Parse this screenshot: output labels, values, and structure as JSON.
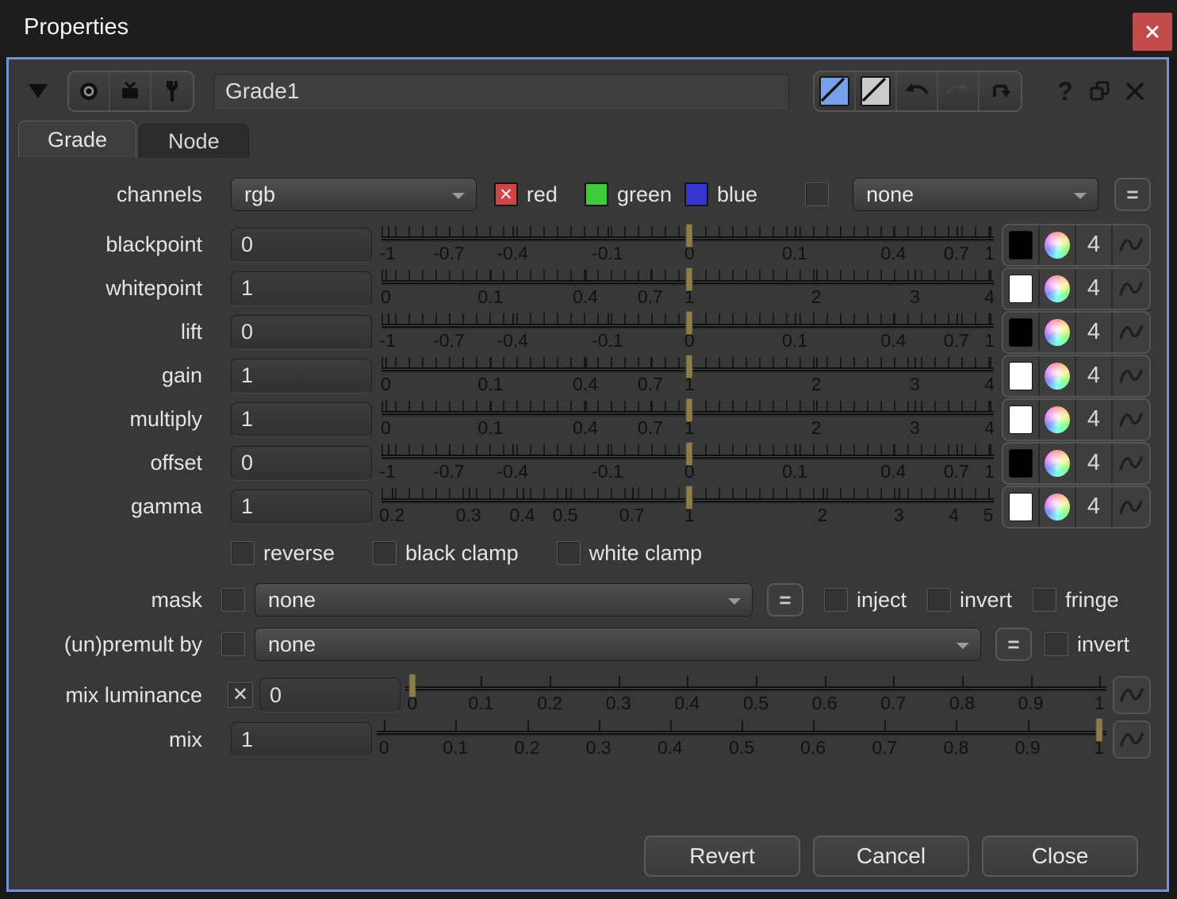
{
  "window": {
    "title": "Properties"
  },
  "toolbar": {
    "node_name": "Grade1",
    "help": "?"
  },
  "tabs": [
    {
      "label": "Grade"
    },
    {
      "label": "Node"
    }
  ],
  "channels": {
    "label": "channels",
    "value": "rgb",
    "red_label": "red",
    "green_label": "green",
    "blue_label": "blue",
    "extra_value": "none",
    "equals": "="
  },
  "params": [
    {
      "label": "blackpoint",
      "value": "0",
      "swatch": "#000000",
      "channels_count": "4",
      "handle_pct": 50.3,
      "ticks": [
        {
          "t": "-1",
          "p": 1
        },
        {
          "t": "-0.7",
          "p": 11
        },
        {
          "t": "-0.4",
          "p": 21.4
        },
        {
          "t": "-0.1",
          "p": 36.9
        },
        {
          "t": "0",
          "p": 50.3
        },
        {
          "t": "0.1",
          "p": 67.5
        },
        {
          "t": "0.4",
          "p": 83.6
        },
        {
          "t": "0.7",
          "p": 93.9
        },
        {
          "t": "1",
          "p": 99.3
        }
      ]
    },
    {
      "label": "whitepoint",
      "value": "1",
      "swatch": "#ffffff",
      "channels_count": "4",
      "handle_pct": 50.3,
      "ticks": [
        {
          "t": "0",
          "p": 0.7
        },
        {
          "t": "0.1",
          "p": 17.8
        },
        {
          "t": "0.4",
          "p": 33.3
        },
        {
          "t": "0.7",
          "p": 43.9
        },
        {
          "t": "1",
          "p": 50.3
        },
        {
          "t": "2",
          "p": 71
        },
        {
          "t": "3",
          "p": 87.1
        },
        {
          "t": "4",
          "p": 99.3
        }
      ]
    },
    {
      "label": "lift",
      "value": "0",
      "swatch": "#000000",
      "channels_count": "4",
      "handle_pct": 50.3,
      "ticks": [
        {
          "t": "-1",
          "p": 1
        },
        {
          "t": "-0.7",
          "p": 11
        },
        {
          "t": "-0.4",
          "p": 21.4
        },
        {
          "t": "-0.1",
          "p": 36.9
        },
        {
          "t": "0",
          "p": 50.3
        },
        {
          "t": "0.1",
          "p": 67.5
        },
        {
          "t": "0.4",
          "p": 83.6
        },
        {
          "t": "0.7",
          "p": 93.9
        },
        {
          "t": "1",
          "p": 99.3
        }
      ]
    },
    {
      "label": "gain",
      "value": "1",
      "swatch": "#ffffff",
      "channels_count": "4",
      "handle_pct": 50.3,
      "ticks": [
        {
          "t": "0",
          "p": 0.7
        },
        {
          "t": "0.1",
          "p": 17.8
        },
        {
          "t": "0.4",
          "p": 33.3
        },
        {
          "t": "0.7",
          "p": 43.9
        },
        {
          "t": "1",
          "p": 50.3
        },
        {
          "t": "2",
          "p": 71
        },
        {
          "t": "3",
          "p": 87.1
        },
        {
          "t": "4",
          "p": 99.3
        }
      ]
    },
    {
      "label": "multiply",
      "value": "1",
      "swatch": "#ffffff",
      "channels_count": "4",
      "handle_pct": 50.3,
      "ticks": [
        {
          "t": "0",
          "p": 0.7
        },
        {
          "t": "0.1",
          "p": 17.8
        },
        {
          "t": "0.4",
          "p": 33.3
        },
        {
          "t": "0.7",
          "p": 43.9
        },
        {
          "t": "1",
          "p": 50.3
        },
        {
          "t": "2",
          "p": 71
        },
        {
          "t": "3",
          "p": 87.1
        },
        {
          "t": "4",
          "p": 99.3
        }
      ]
    },
    {
      "label": "offset",
      "value": "0",
      "swatch": "#000000",
      "channels_count": "4",
      "handle_pct": 50.3,
      "ticks": [
        {
          "t": "-1",
          "p": 1
        },
        {
          "t": "-0.7",
          "p": 11
        },
        {
          "t": "-0.4",
          "p": 21.4
        },
        {
          "t": "-0.1",
          "p": 36.9
        },
        {
          "t": "0",
          "p": 50.3
        },
        {
          "t": "0.1",
          "p": 67.5
        },
        {
          "t": "0.4",
          "p": 83.6
        },
        {
          "t": "0.7",
          "p": 93.9
        },
        {
          "t": "1",
          "p": 99.3
        }
      ]
    },
    {
      "label": "gamma",
      "value": "1",
      "swatch": "#ffffff",
      "channels_count": "4",
      "handle_pct": 50.3,
      "ticks": [
        {
          "t": "0.2",
          "p": 1.7
        },
        {
          "t": "0.3",
          "p": 14.2
        },
        {
          "t": "0.4",
          "p": 23
        },
        {
          "t": "0.5",
          "p": 30
        },
        {
          "t": "0.7",
          "p": 40.9
        },
        {
          "t": "1",
          "p": 50.3
        },
        {
          "t": "2",
          "p": 72
        },
        {
          "t": "3",
          "p": 84.5
        },
        {
          "t": "4",
          "p": 93.5
        },
        {
          "t": "5",
          "p": 99.1
        }
      ]
    }
  ],
  "clamps": [
    {
      "label": "reverse"
    },
    {
      "label": "black clamp"
    },
    {
      "label": "white clamp"
    }
  ],
  "mask": {
    "label": "mask",
    "value": "none",
    "equals": "=",
    "checks": [
      {
        "label": "inject"
      },
      {
        "label": "invert"
      },
      {
        "label": "fringe"
      }
    ]
  },
  "premult": {
    "label": "(un)premult by",
    "value": "none",
    "equals": "=",
    "invert_label": "invert"
  },
  "mix_rows": [
    {
      "label": "mix luminance",
      "value": "0",
      "checked": true,
      "handle_pct": 1,
      "ticks": [
        {
          "t": "0",
          "p": 1
        },
        {
          "t": "0.1",
          "p": 10.8
        },
        {
          "t": "0.2",
          "p": 20.6
        },
        {
          "t": "0.3",
          "p": 30.4
        },
        {
          "t": "0.4",
          "p": 40.2
        },
        {
          "t": "0.5",
          "p": 50
        },
        {
          "t": "0.6",
          "p": 59.8
        },
        {
          "t": "0.7",
          "p": 69.6
        },
        {
          "t": "0.8",
          "p": 79.4
        },
        {
          "t": "0.9",
          "p": 89.2
        },
        {
          "t": "1",
          "p": 99
        }
      ]
    },
    {
      "label": "mix",
      "value": "1",
      "checked": null,
      "handle_pct": 99,
      "ticks": [
        {
          "t": "0",
          "p": 1
        },
        {
          "t": "0.1",
          "p": 10.8
        },
        {
          "t": "0.2",
          "p": 20.6
        },
        {
          "t": "0.3",
          "p": 30.4
        },
        {
          "t": "0.4",
          "p": 40.2
        },
        {
          "t": "0.5",
          "p": 50
        },
        {
          "t": "0.6",
          "p": 59.8
        },
        {
          "t": "0.7",
          "p": 69.6
        },
        {
          "t": "0.8",
          "p": 79.4
        },
        {
          "t": "0.9",
          "p": 89.2
        },
        {
          "t": "1",
          "p": 99
        }
      ]
    }
  ],
  "footer": {
    "revert": "Revert",
    "cancel": "Cancel",
    "close": "Close"
  },
  "colors": {
    "accent_border": "#7193dd",
    "window_close_red": "#c24b4b",
    "red_channel": "#d04545",
    "green_channel": "#3ecb3e",
    "blue_channel": "#3636d0",
    "slider_handle": "#8d7c4e"
  }
}
